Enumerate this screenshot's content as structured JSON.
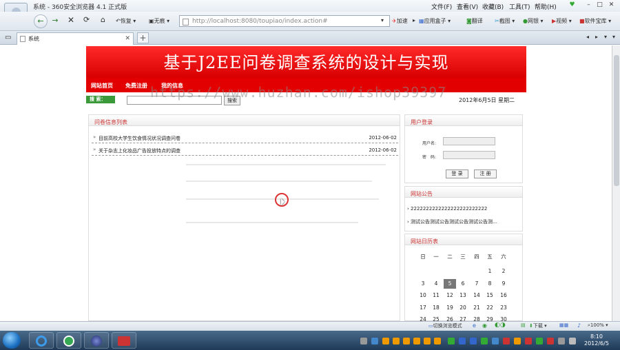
{
  "browser": {
    "title": "系统 - 360安全浏览器 4.1 正式版",
    "avatar_label": "登录",
    "menu": [
      "文件(F)",
      "查看(V)",
      "收藏(B)",
      "工具(T)",
      "帮助(H)"
    ],
    "toolbar": {
      "restore_label": "恢复",
      "nodraw_label": "无痕",
      "accel_label": "加速",
      "app_box_label": "应用盒子",
      "translate_label": "翻译",
      "screenshot_label": "截图",
      "bank_label": "网银",
      "video_label": "视频",
      "software_label": "软件宝库"
    },
    "url": "http://localhost:8080/toupiao/index.action#",
    "tab_label": "系统",
    "statusbar": {
      "mode_label": "切换浏览模式",
      "download_label": "下载",
      "zoom": "100%"
    }
  },
  "page": {
    "banner_title": "基于J2EE问卷调查系统的设计与实现",
    "nav": [
      "网站首页",
      "免费注册",
      "我的信息"
    ],
    "search": {
      "label": "搜 索：",
      "button": "搜索"
    },
    "date": "2012年6月5日 星期二",
    "watermark": "https://www.huzhan.com/ishop39397",
    "survey_list": {
      "title": "问卷信息列表",
      "items": [
        {
          "title": "目前高校大学生饮食情况状况调查问卷",
          "date": "2012-06-02"
        },
        {
          "title": "关于杂志上化妆品广告投放特点的调查",
          "date": "2012-06-02"
        }
      ]
    },
    "login": {
      "title": "用户登录",
      "username_label": "用户名:",
      "password_label": "密　码:",
      "login_button": "登 录",
      "register_button": "注 册"
    },
    "notices": {
      "title": "网站公告",
      "items": [
        "2222222222222222222222222",
        "测试公告测试公告测试公告测试公告测…"
      ]
    },
    "calendar": {
      "title": "网站日历表",
      "weekdays": [
        "日",
        "一",
        "二",
        "三",
        "四",
        "五",
        "六"
      ],
      "rows": [
        [
          "",
          "",
          "",
          "",
          "",
          "1",
          "2"
        ],
        [
          "3",
          "4",
          "5",
          "6",
          "7",
          "8",
          "9"
        ],
        [
          "10",
          "11",
          "12",
          "13",
          "14",
          "15",
          "16"
        ],
        [
          "17",
          "18",
          "19",
          "20",
          "21",
          "22",
          "23"
        ],
        [
          "24",
          "25",
          "26",
          "27",
          "28",
          "29",
          "30"
        ]
      ],
      "today": "5"
    }
  },
  "taskbar": {
    "time": "8:10",
    "date": "2012/6/5"
  },
  "colors": {
    "banner_red": "#e20000",
    "search_green": "#3a9a3a",
    "heading_red": "#cc3333"
  }
}
